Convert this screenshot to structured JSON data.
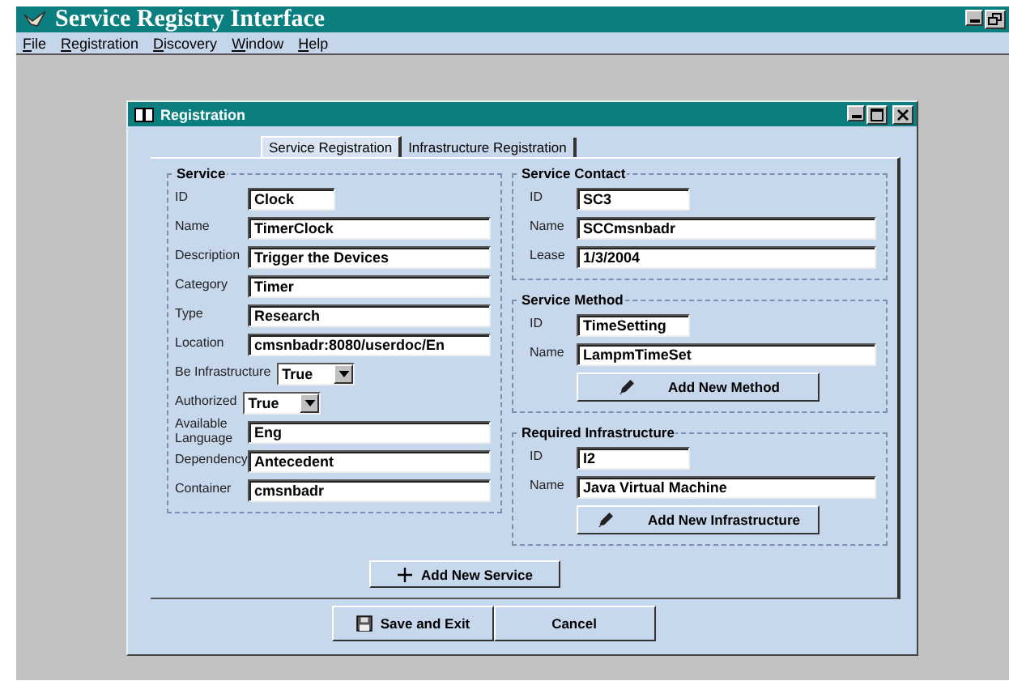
{
  "window": {
    "title": "Service Registry Interface"
  },
  "menu": [
    {
      "label": "File"
    },
    {
      "label": "Registration"
    },
    {
      "label": "Discovery"
    },
    {
      "label": "Window"
    },
    {
      "label": "Help"
    }
  ],
  "dialog": {
    "title": "Registration",
    "tabs": [
      {
        "label": "Service Registration",
        "selected": true
      },
      {
        "label": "Infrastructure Registration",
        "selected": false
      }
    ],
    "service": {
      "title": "Service",
      "fields": [
        {
          "kind": "text",
          "label": "ID",
          "value": "Clock"
        },
        {
          "kind": "text",
          "label": "Name",
          "value": "TimerClock"
        },
        {
          "kind": "text",
          "label": "Description",
          "value": "Trigger the Devices"
        },
        {
          "kind": "text",
          "label": "Category",
          "value": "Timer"
        },
        {
          "kind": "text",
          "label": "Type",
          "value": "Research"
        },
        {
          "kind": "text",
          "label": "Location",
          "value": "cmsnbadr:8080/userdoc/En"
        },
        {
          "kind": "select",
          "label": "Be Infrastructure",
          "value": "True"
        },
        {
          "kind": "select",
          "label": "Authorized",
          "value": "True"
        },
        {
          "kind": "text",
          "label": "Available Language",
          "value": "Eng"
        },
        {
          "kind": "text",
          "label": "Dependency",
          "value": "Antecedent"
        },
        {
          "kind": "text",
          "label": "Container",
          "value": "cmsnbadr"
        }
      ]
    },
    "groups": [
      {
        "title": "Service Contact",
        "fields": [
          {
            "label": "ID",
            "value": "SC3"
          },
          {
            "label": "Name",
            "value": "SCCmsnbadr"
          },
          {
            "label": "Lease",
            "value": "1/3/2004"
          }
        ]
      },
      {
        "title": "Service Method",
        "fields": [
          {
            "label": "ID",
            "value": "TimeSetting"
          },
          {
            "label": "Name",
            "value": "LampmTimeSet"
          }
        ],
        "button": {
          "label": "Add New Method",
          "kind": "pencil"
        }
      },
      {
        "title": "Required Infrastructure",
        "fields": [
          {
            "label": "ID",
            "value": "I2"
          },
          {
            "label": "Name",
            "value": "Java Virtual Machine"
          }
        ],
        "button": {
          "label": "Add New Infrastructure",
          "kind": "pencil"
        }
      }
    ],
    "add_button": {
      "label": "Add New Service",
      "kind": "plus"
    },
    "buttons": [
      {
        "label": "Save and Exit",
        "kind": "save"
      },
      {
        "label": "Cancel",
        "kind": "plain"
      }
    ]
  }
}
